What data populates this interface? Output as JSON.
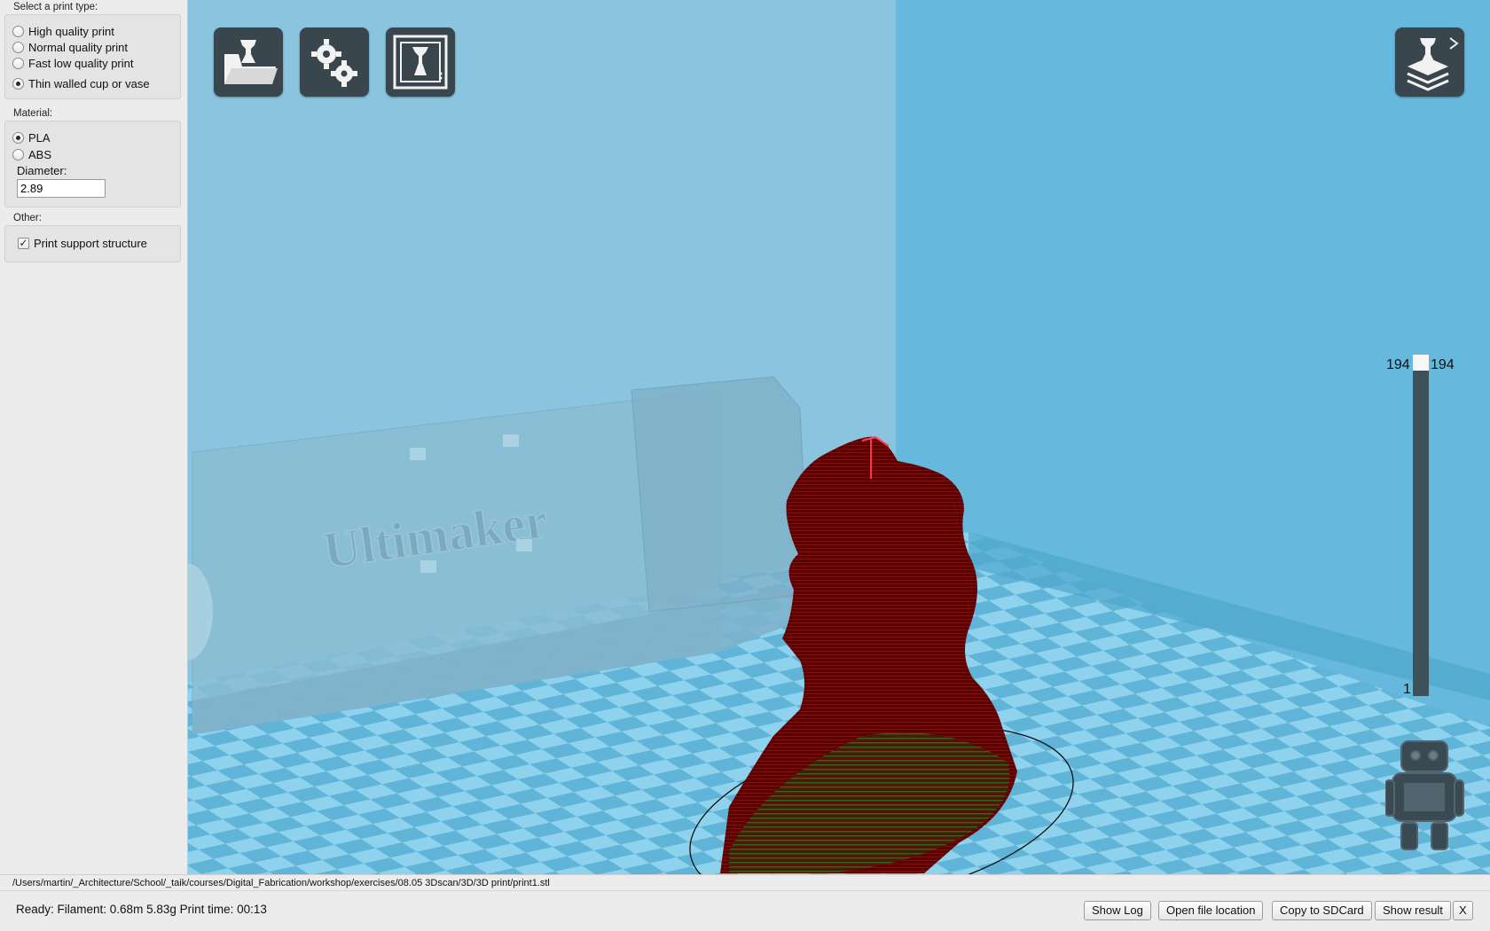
{
  "sidebar": {
    "print_type_title": "Select a print type:",
    "print_types": [
      {
        "label": "High quality print",
        "selected": false
      },
      {
        "label": "Normal quality print",
        "selected": false
      },
      {
        "label": "Fast low quality print",
        "selected": false
      },
      {
        "label": "Thin walled cup or vase",
        "selected": true
      }
    ],
    "material_title": "Material:",
    "materials": [
      {
        "label": "PLA",
        "selected": true
      },
      {
        "label": "ABS",
        "selected": false
      }
    ],
    "diameter_label": "Diameter:",
    "diameter_value": "2.89",
    "other_title": "Other:",
    "support_label": "Print support structure",
    "support_checked": true
  },
  "viewport": {
    "toolbar": {
      "load_icon": "load-model-icon",
      "settings_icon": "gears-icon",
      "view_icon": "view-mode-icon",
      "layers_icon": "layer-view-icon"
    },
    "printer_label": "Ultimaker",
    "layers": {
      "top_left": "194",
      "top_right": "194",
      "bottom": "1",
      "current": 194,
      "max": 194
    }
  },
  "file_path": "/Users/martin/_Architecture/School/_taik/courses/Digital_Fabrication/workshop/exercises/08.05 3Dscan/3D/3D print/print1.stl",
  "status": {
    "text": "Ready: Filament: 0.68m 5.83g Print time: 00:13",
    "buttons": {
      "show_log": "Show Log",
      "open_location": "Open file location",
      "copy_sd": "Copy to SDCard",
      "show_result": "Show result",
      "close": "X"
    }
  },
  "colors": {
    "viewport_bg": "#6cb9da",
    "model": "#5c0303",
    "toolbar_button": "#3a464d"
  }
}
